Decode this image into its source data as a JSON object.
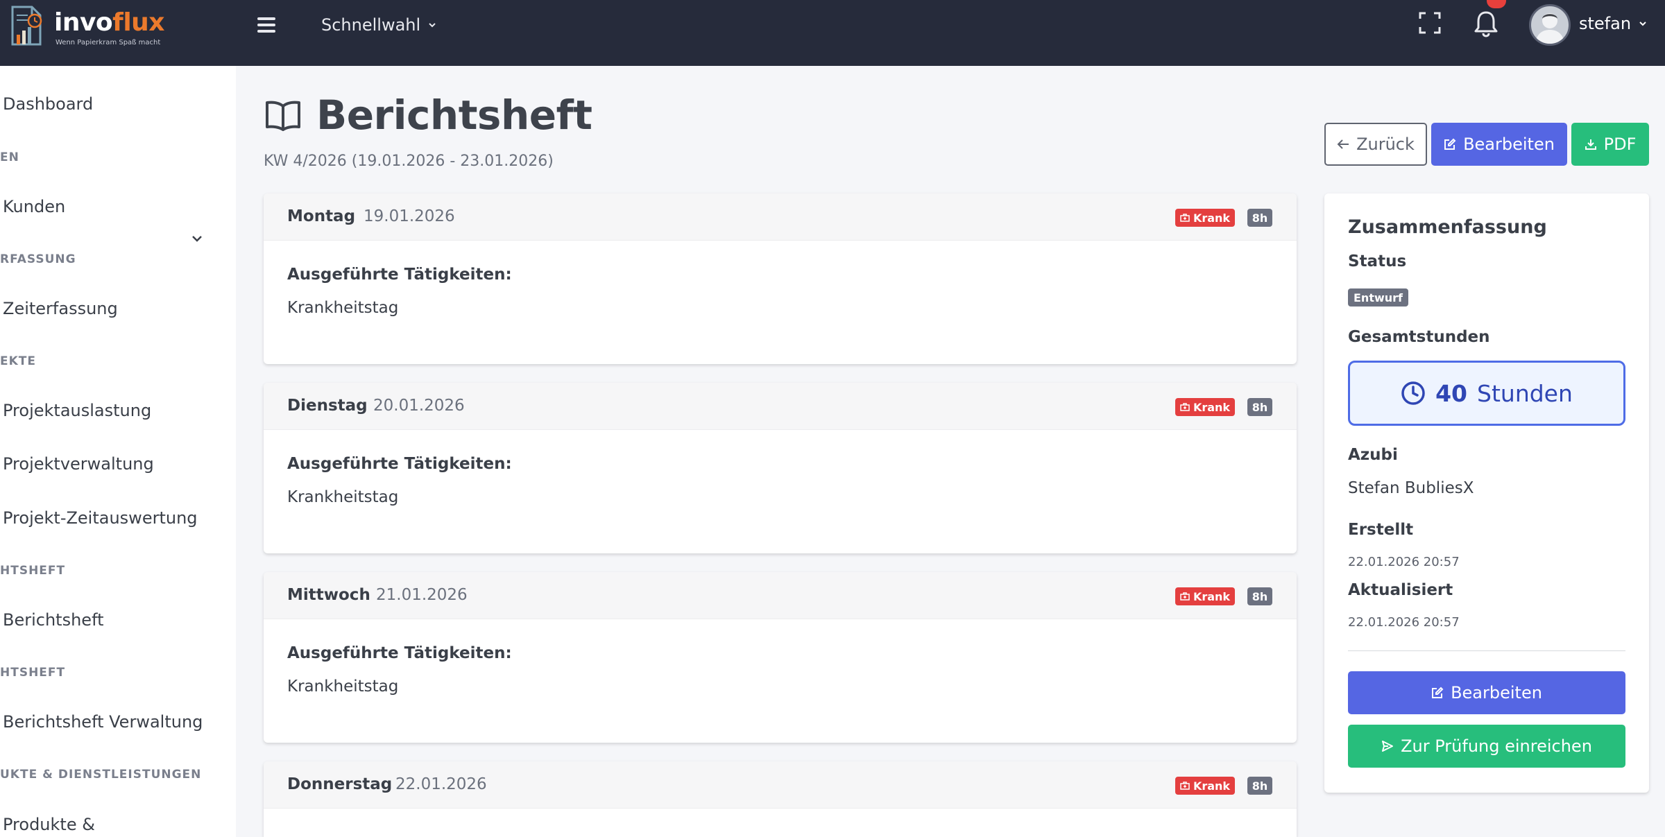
{
  "brand": {
    "name_part1": "invo",
    "name_part2": "flux",
    "tagline": "Wenn Papierkram Spaß macht",
    "accent_color": "#ec7a2c"
  },
  "topbar": {
    "menu_icon": "hamburger-icon",
    "quick_select_label": "Schnellwahl",
    "fullscreen_icon": "fullscreen-icon",
    "notification_icon": "bell-icon",
    "user_name": "stefan"
  },
  "sidebar": {
    "items": [
      {
        "type": "link",
        "label": "Dashboard"
      },
      {
        "type": "section",
        "label": "EN"
      },
      {
        "type": "link",
        "label": "Kunden"
      },
      {
        "type": "section",
        "label": "RFASSUNG"
      },
      {
        "type": "link",
        "label": "Zeiterfassung",
        "expandable": true
      },
      {
        "type": "section",
        "label": "EKTE"
      },
      {
        "type": "link",
        "label": "Projektauslastung"
      },
      {
        "type": "link",
        "label": "Projektverwaltung"
      },
      {
        "type": "link",
        "label": "Projekt-Zeitauswertung"
      },
      {
        "type": "section",
        "label": "HTSHEFT"
      },
      {
        "type": "link",
        "label": "Berichtsheft"
      },
      {
        "type": "section",
        "label": "HTSHEFT"
      },
      {
        "type": "link",
        "label": "Berichtsheft Verwaltung"
      },
      {
        "type": "section",
        "label": "UKTE & DIENSTLEISTUNGEN"
      },
      {
        "type": "link",
        "label": "Produkte &"
      }
    ]
  },
  "page": {
    "title": "Berichtsheft",
    "title_icon": "book-open-icon",
    "subtitle": "KW 4/2026 (19.01.2026 - 23.01.2026)",
    "actions": {
      "back_label": "Zurück",
      "edit_label": "Bearbeiten",
      "pdf_label": "PDF"
    }
  },
  "days": [
    {
      "name": "Montag",
      "date": "19.01.2026",
      "status": "Krank",
      "hours": "8h",
      "activities_label": "Ausgeführte Tätigkeiten:",
      "activities": "Krankheitstag"
    },
    {
      "name": "Dienstag",
      "date": "20.01.2026",
      "status": "Krank",
      "hours": "8h",
      "activities_label": "Ausgeführte Tätigkeiten:",
      "activities": "Krankheitstag"
    },
    {
      "name": "Mittwoch",
      "date": "21.01.2026",
      "status": "Krank",
      "hours": "8h",
      "activities_label": "Ausgeführte Tätigkeiten:",
      "activities": "Krankheitstag"
    },
    {
      "name": "Donnerstag",
      "date": "22.01.2026",
      "status": "Krank",
      "hours": "8h",
      "activities_label": "",
      "activities": ""
    }
  ],
  "summary": {
    "title": "Zusammenfassung",
    "status_label": "Status",
    "status_value": "Entwurf",
    "total_hours_label": "Gesamtstunden",
    "total_hours_value": "40",
    "total_hours_unit": "Stunden",
    "trainee_label": "Azubi",
    "trainee_value": "Stefan BubliesX",
    "created_label": "Erstellt",
    "created_value": "22.01.2026 20:57",
    "updated_label": "Aktualisiert",
    "updated_value": "22.01.2026 20:57",
    "edit_button": "Bearbeiten",
    "submit_button": "Zur Prüfung einreichen"
  },
  "colors": {
    "topbar_bg": "#262b3b",
    "primary": "#5566e3",
    "success": "#27be7c",
    "danger": "#e43f3f",
    "secondary": "#6c7180"
  }
}
